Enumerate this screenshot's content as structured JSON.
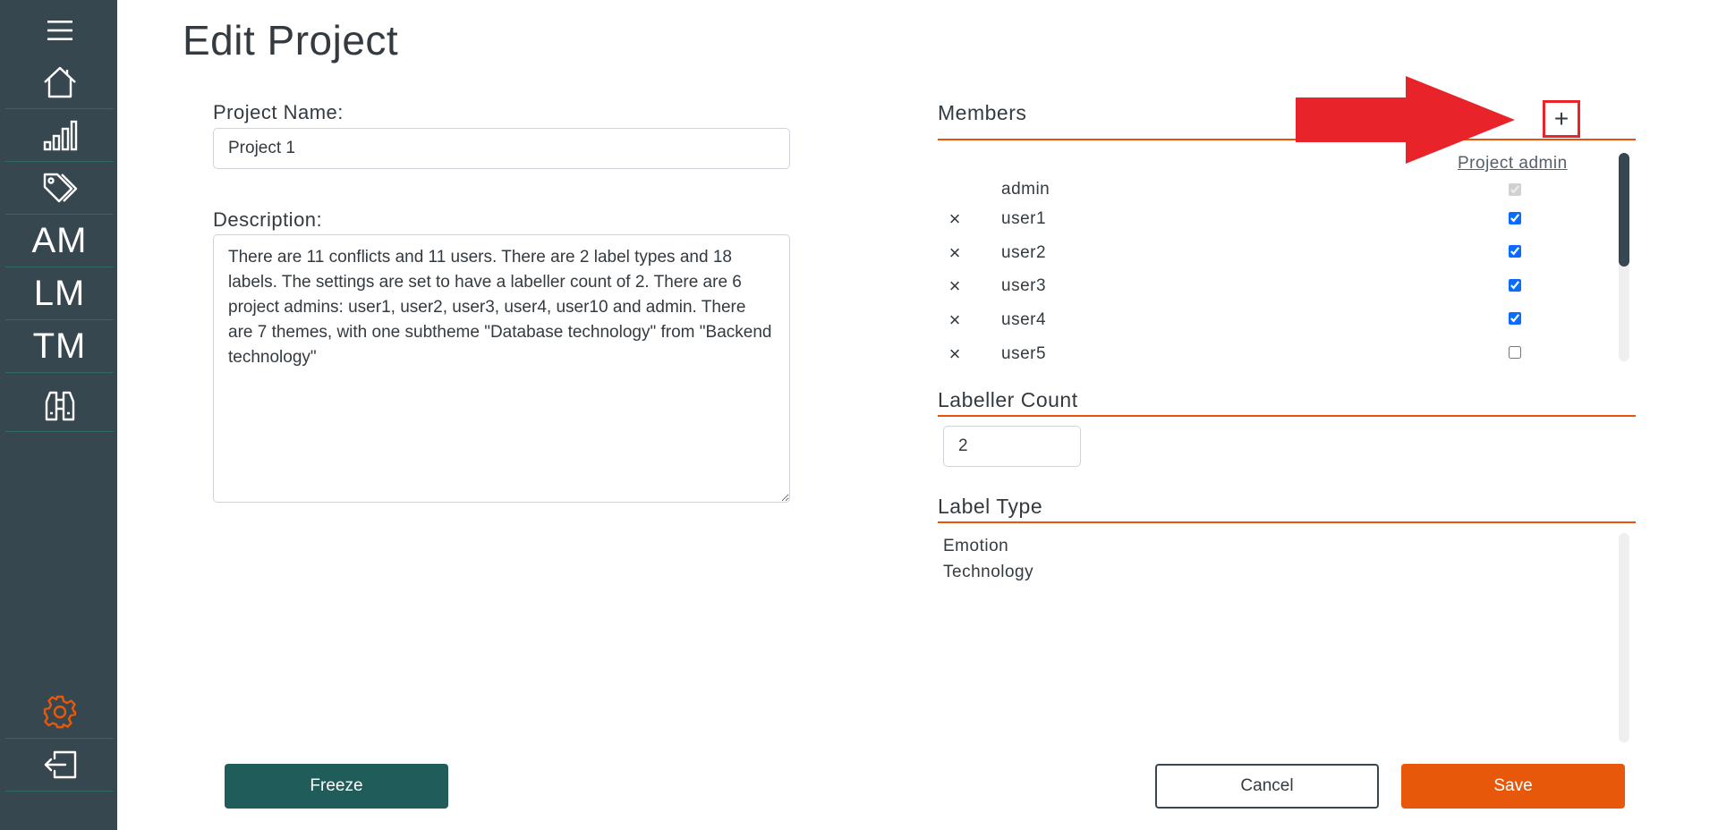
{
  "sidebar": {
    "items": [
      {
        "icon": "menu-icon"
      },
      {
        "icon": "home-icon"
      },
      {
        "icon": "bar-chart-icon"
      },
      {
        "icon": "tags-icon"
      },
      {
        "label": "AM"
      },
      {
        "label": "LM"
      },
      {
        "label": "TM"
      },
      {
        "icon": "binoculars-icon"
      },
      {
        "icon": "gear-icon",
        "color": "#e8580a"
      },
      {
        "icon": "logout-icon"
      }
    ]
  },
  "page": {
    "title": "Edit Project"
  },
  "form": {
    "project_name_label": "Project Name:",
    "project_name_value": "Project 1",
    "description_label": "Description:",
    "description_value": "There are 11 conflicts and 11 users. There are 2 label types and 18 labels. The settings are set to have a labeller count of 2. There are 6 project admins: user1, user2, user3, user4, user10 and admin. There are 7 themes, with one subtheme \"Database technology\" from \"Backend technology\""
  },
  "members": {
    "heading": "Members",
    "add_label": "+",
    "admin_column_label": "Project admin",
    "remove_label": "×",
    "rows": [
      {
        "name": "admin",
        "is_admin": true,
        "removable": false,
        "disabled": true
      },
      {
        "name": "user1",
        "is_admin": true,
        "removable": true
      },
      {
        "name": "user2",
        "is_admin": true,
        "removable": true
      },
      {
        "name": "user3",
        "is_admin": true,
        "removable": true
      },
      {
        "name": "user4",
        "is_admin": true,
        "removable": true
      },
      {
        "name": "user5",
        "is_admin": false,
        "removable": true
      }
    ]
  },
  "labeller_count": {
    "heading": "Labeller Count",
    "value": "2"
  },
  "label_type": {
    "heading": "Label Type",
    "items": [
      "Emotion",
      "Technology"
    ]
  },
  "buttons": {
    "freeze": "Freeze",
    "cancel": "Cancel",
    "save": "Save"
  },
  "colors": {
    "accent": "#e8580a",
    "sidebar": "#37474f",
    "freeze": "#1f5c5a",
    "highlight": "#e8242a"
  }
}
